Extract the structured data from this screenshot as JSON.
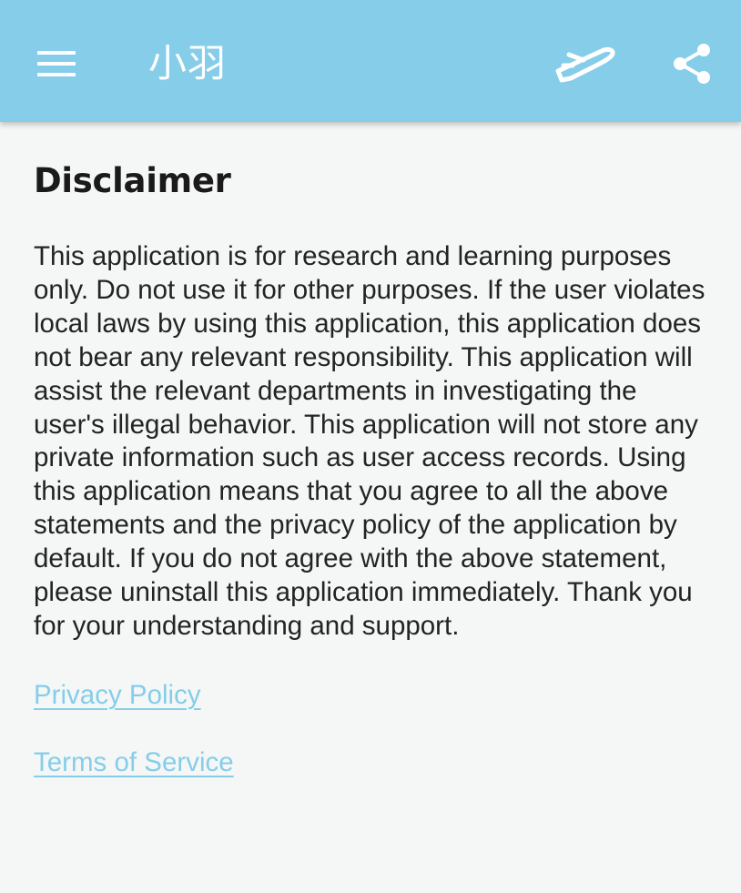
{
  "app_bar": {
    "title": "小羽",
    "background_color": "#86cdea",
    "icons": [
      "menu-icon",
      "paper-plane-icon",
      "share-icon"
    ]
  },
  "disclaimer": {
    "heading": "Disclaimer",
    "body": "This application is for research and learning purposes only. Do not use it for other purposes. If the user violates local laws by using this application, this application does not bear any relevant responsibility. This application will assist the relevant departments in investigating the user's illegal behavior. This application will not store any private information such as user access records. Using this application means that you agree to all the above statements and the privacy policy of the application by default. If you do not agree with the above statement, please uninstall this application immediately. Thank you for your understanding and support."
  },
  "links": {
    "privacy_policy": "Privacy Policy",
    "terms_of_service": "Terms of Service",
    "link_color": "#86cdea"
  }
}
